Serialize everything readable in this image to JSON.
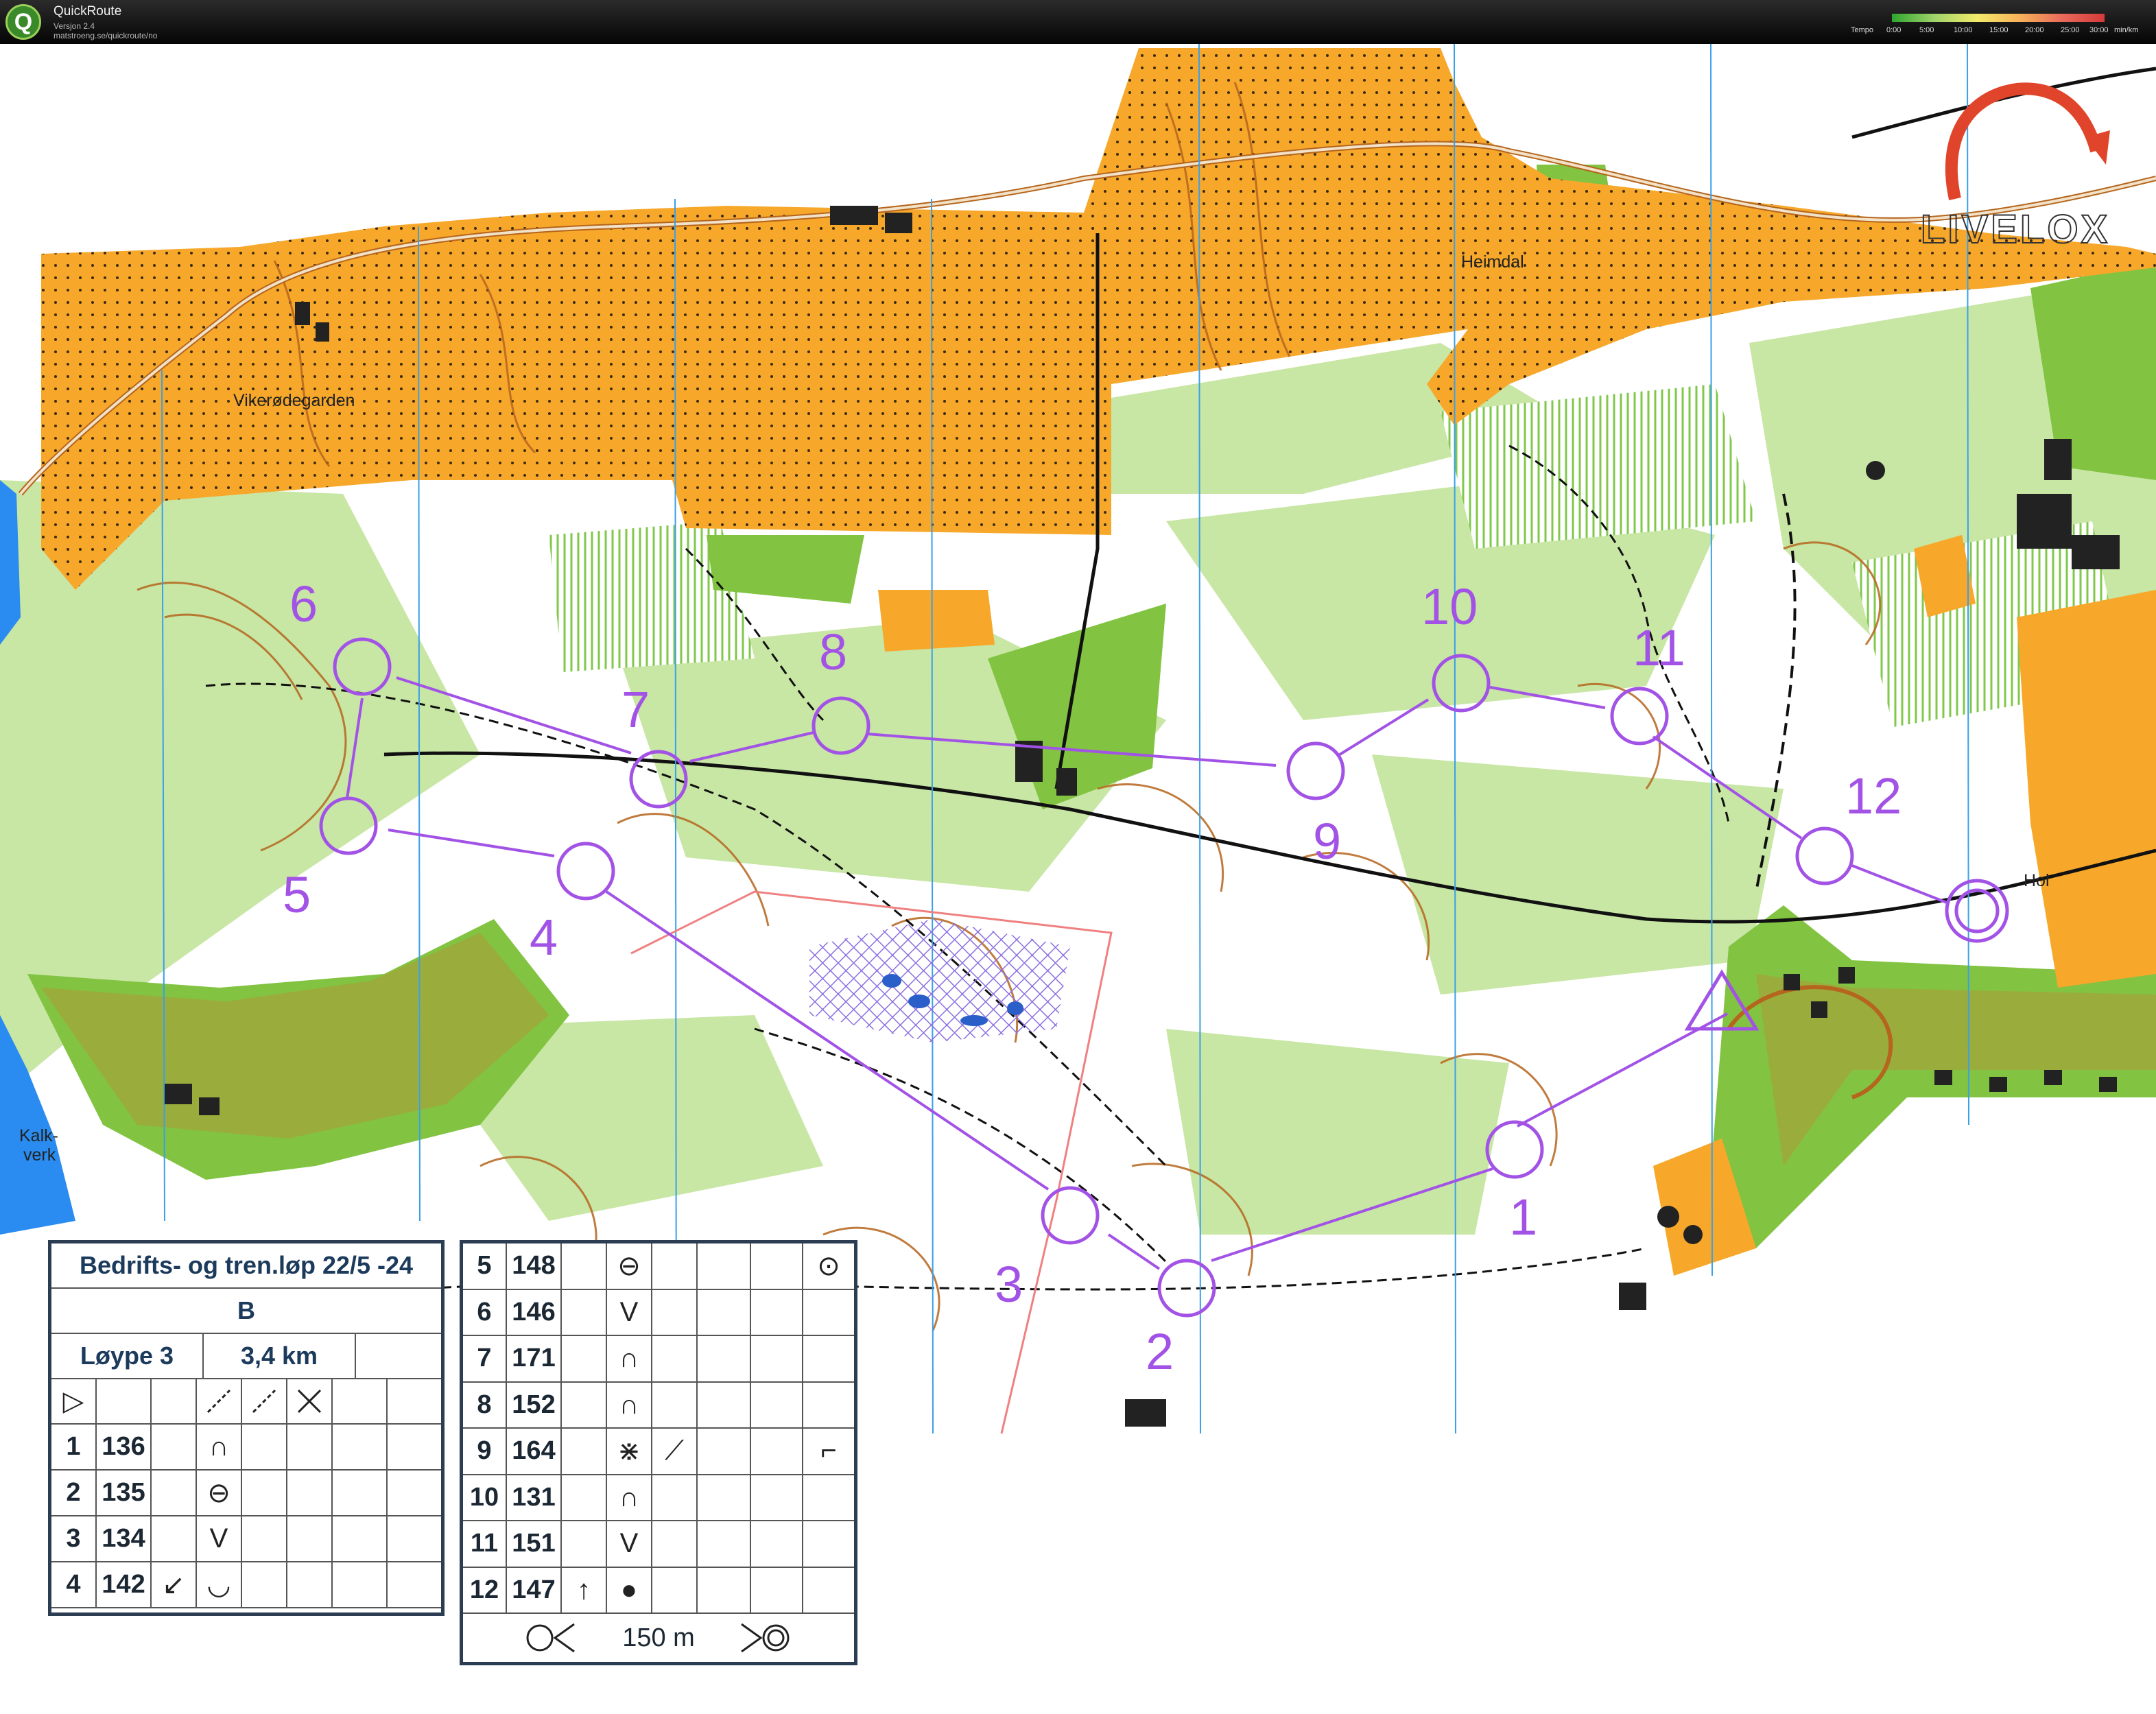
{
  "app": {
    "name": "QuickRoute",
    "version": "Versjon 2.4",
    "url": "matstroeng.se/quickroute/no",
    "logo_letter": "Q"
  },
  "tempo_legend": {
    "label": "Tempo",
    "ticks": [
      "0:00",
      "5:00",
      "10:00",
      "15:00",
      "20:00",
      "25:00",
      "30:00"
    ],
    "unit": "min/km"
  },
  "watermark": "LIVELOX",
  "map": {
    "place_names": {
      "viker": "Viker",
      "vikerodegarden": "Vikerødegarden",
      "heimdal": "Heimdal",
      "kalkverk_1": "Kalk-",
      "kalkverk_2": "verk",
      "hol": "Hol"
    },
    "controls": [
      "1",
      "2",
      "3",
      "4",
      "5",
      "6",
      "7",
      "8",
      "9",
      "10",
      "11",
      "12"
    ],
    "colors": {
      "course": "#a253e6",
      "open_land": "#f7a82a",
      "forest_green": "#82c341",
      "light_green": "#c8e6a4",
      "contour": "#b5651d",
      "magnetic_north": "#3aa0e8",
      "water": "#2a8cf0"
    }
  },
  "description": {
    "title": "Bedrifts- og tren.løp 22/5 -24",
    "category": "B",
    "course": "Løype 3",
    "length": "3,4 km",
    "start_symbol": "▷",
    "controls": [
      {
        "num": "1",
        "code": "136",
        "feature": "∩"
      },
      {
        "num": "2",
        "code": "135",
        "feature": "⊖"
      },
      {
        "num": "3",
        "code": "134",
        "feature": "V"
      },
      {
        "num": "4",
        "code": "142",
        "which": "↙",
        "feature": "◡"
      },
      {
        "num": "5",
        "code": "148",
        "feature": "⊖",
        "location": "⊙"
      },
      {
        "num": "6",
        "code": "146",
        "feature": "V"
      },
      {
        "num": "7",
        "code": "171",
        "feature": "∩"
      },
      {
        "num": "8",
        "code": "152",
        "feature": "∩"
      },
      {
        "num": "9",
        "code": "164",
        "feature": "⋇",
        "appearance": "⟋",
        "location": "⌐"
      },
      {
        "num": "10",
        "code": "131",
        "feature": "∩"
      },
      {
        "num": "11",
        "code": "151",
        "feature": "V"
      },
      {
        "num": "12",
        "code": "147",
        "which": "↑",
        "feature": "●"
      }
    ],
    "finish_distance": "150 m"
  }
}
